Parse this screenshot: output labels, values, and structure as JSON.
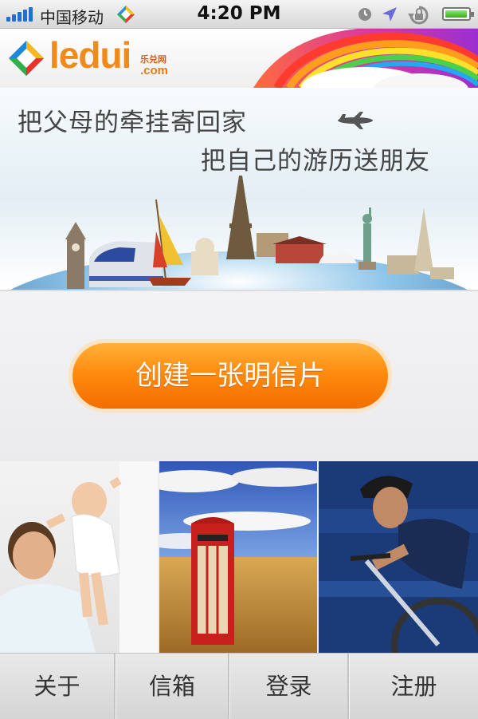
{
  "status_bar": {
    "carrier": "中国移动",
    "time": "4:20 PM"
  },
  "header": {
    "logo_text": "ledui",
    "logo_cn": "乐兑网",
    "logo_com": ".com"
  },
  "banner": {
    "tagline_1": "把父母的牵挂寄回家",
    "tagline_2": "把自己的游历送朋友"
  },
  "cta": {
    "label": "创建一张明信片"
  },
  "photos": [
    {
      "name": "family"
    },
    {
      "name": "phone-booth"
    },
    {
      "name": "cyclist"
    }
  ],
  "tabs": [
    {
      "label": "关于"
    },
    {
      "label": "信箱"
    },
    {
      "label": "登录"
    },
    {
      "label": "注册"
    }
  ],
  "colors": {
    "accent_orange": "#ff8c0f",
    "signal_blue": "#1f6fd6",
    "battery_green": "#3caa22"
  }
}
